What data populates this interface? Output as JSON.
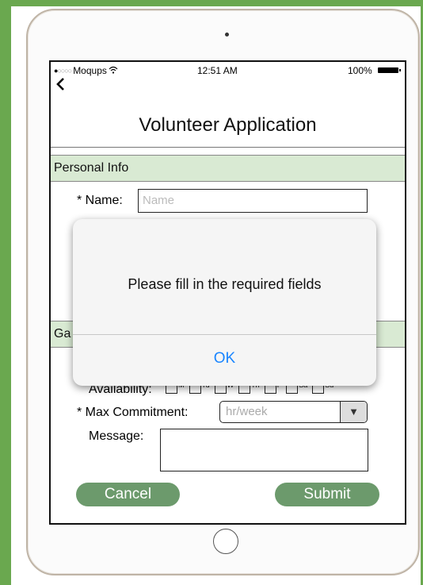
{
  "status_bar": {
    "carrier": "Moqups",
    "time": "12:51 AM",
    "battery": "100%"
  },
  "header": {
    "back_icon": "chevron-left-icon",
    "title": "Volunteer Application"
  },
  "sections": {
    "personal": "Personal Info",
    "general_partial": "Ga"
  },
  "name_field": {
    "label": "* Name:",
    "placeholder": "Name",
    "value": ""
  },
  "availability": {
    "label": "Availability:",
    "days": [
      "M",
      "Tu",
      "W",
      "Th",
      "F",
      "Sa",
      "Su"
    ]
  },
  "max_commitment": {
    "label": "* Max Commitment:",
    "placeholder": "hr/week",
    "arrow": "▼"
  },
  "message": {
    "label": "Message:",
    "value": ""
  },
  "buttons": {
    "cancel": "Cancel",
    "submit": "Submit"
  },
  "alert": {
    "message": "Please fill in the required fields",
    "ok": "OK"
  },
  "colors": {
    "section_bg": "#d9ead3",
    "button_green": "#6c9a6c",
    "ios_blue": "#1a85ff",
    "frame_green": "#6aa84f"
  }
}
